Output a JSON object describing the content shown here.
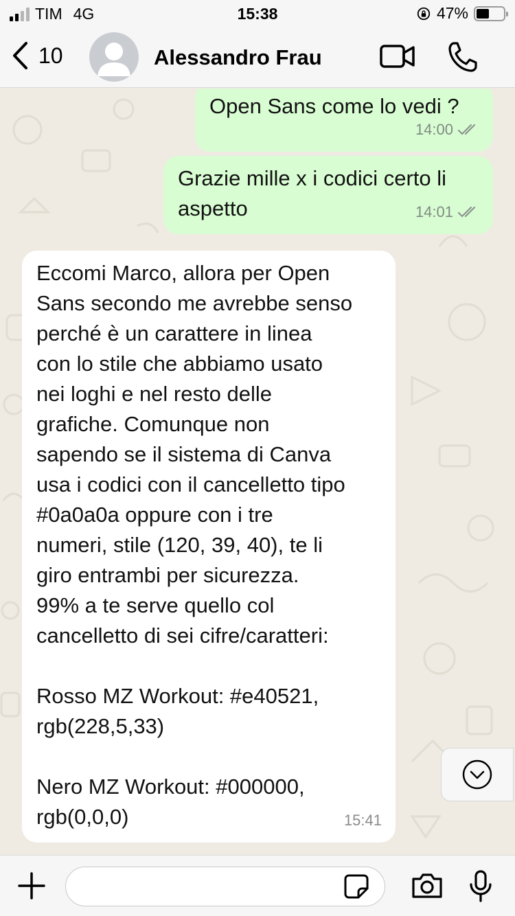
{
  "status_bar": {
    "carrier": "TIM",
    "network": "4G",
    "time": "15:38",
    "battery": "47%",
    "battery_level": 0.47
  },
  "header": {
    "back_count": "10",
    "contact_name": "Alessandro Frau"
  },
  "messages": [
    {
      "direction": "outgoing",
      "text": "Open Sans come lo vedi ?",
      "time": "14:00",
      "status_icon": "double-check-icon"
    },
    {
      "direction": "outgoing",
      "text": "Grazie mille x i codici certo li\naspetto",
      "time": "14:01",
      "status_icon": "double-check-icon"
    },
    {
      "direction": "incoming",
      "text": "Eccomi Marco, allora per Open\nSans secondo me avrebbe senso\nperché è un carattere in linea\ncon lo stile che abbiamo usato\nnei loghi e nel resto delle\ngrafiche. Comunque non\nsapendo se il sistema di Canva\nusa i codici con il cancelletto tipo\n#0a0a0a oppure con i tre\nnumeri, stile (120, 39, 40), te li\ngiro entrambi per sicurezza.\n99% a te serve quello col\ncancelletto di sei cifre/caratteri:\n\nRosso MZ Workout: #e40521,\nrgb(228,5,33)\n\nNero MZ Workout: #000000,\nrgb(0,0,0)",
      "time": "15:41"
    }
  ],
  "composer": {
    "value": "",
    "placeholder": ""
  },
  "colors": {
    "outgoing_bubble": "#d9fdd3",
    "incoming_bubble": "#ffffff",
    "chat_background": "#efeae2",
    "bar_background": "#f6f6f6"
  }
}
